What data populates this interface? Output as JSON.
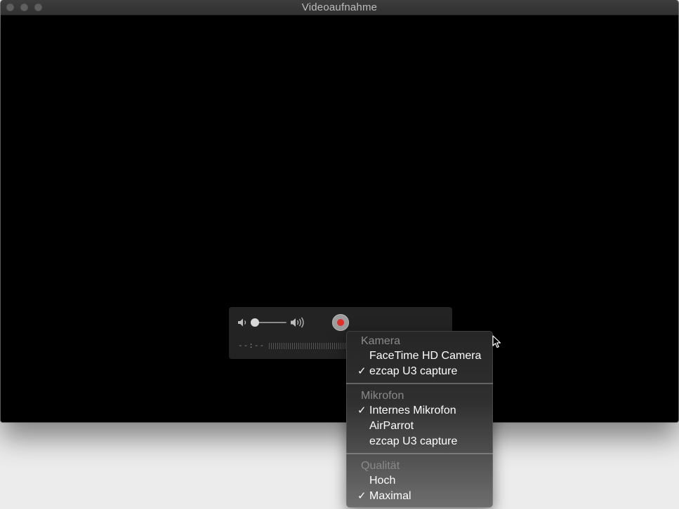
{
  "window": {
    "title": "Videoaufnahme"
  },
  "controls": {
    "time": "--:--",
    "volume_fraction": 0.0
  },
  "menu": {
    "sections": {
      "camera": {
        "title": "Kamera",
        "items": [
          {
            "label": "FaceTime HD Camera",
            "checked": false
          },
          {
            "label": "ezcap U3 capture",
            "checked": true
          }
        ]
      },
      "microphone": {
        "title": "Mikrofon",
        "items": [
          {
            "label": "Internes Mikrofon",
            "checked": true
          },
          {
            "label": "AirParrot",
            "checked": false
          },
          {
            "label": "ezcap U3 capture",
            "checked": false
          }
        ]
      },
      "quality": {
        "title": "Qualität",
        "items": [
          {
            "label": "Hoch",
            "checked": false
          },
          {
            "label": "Maximal",
            "checked": true
          }
        ]
      }
    },
    "check_glyph": "✓"
  },
  "colors": {
    "record": "#e2302a"
  },
  "icons": {
    "close": "close-icon",
    "minimize": "minimize-icon",
    "maximize": "maximize-icon",
    "volume_low": "speaker-low-icon",
    "volume_high": "speaker-high-icon",
    "record": "record-icon",
    "cursor": "mouse-pointer-icon"
  }
}
